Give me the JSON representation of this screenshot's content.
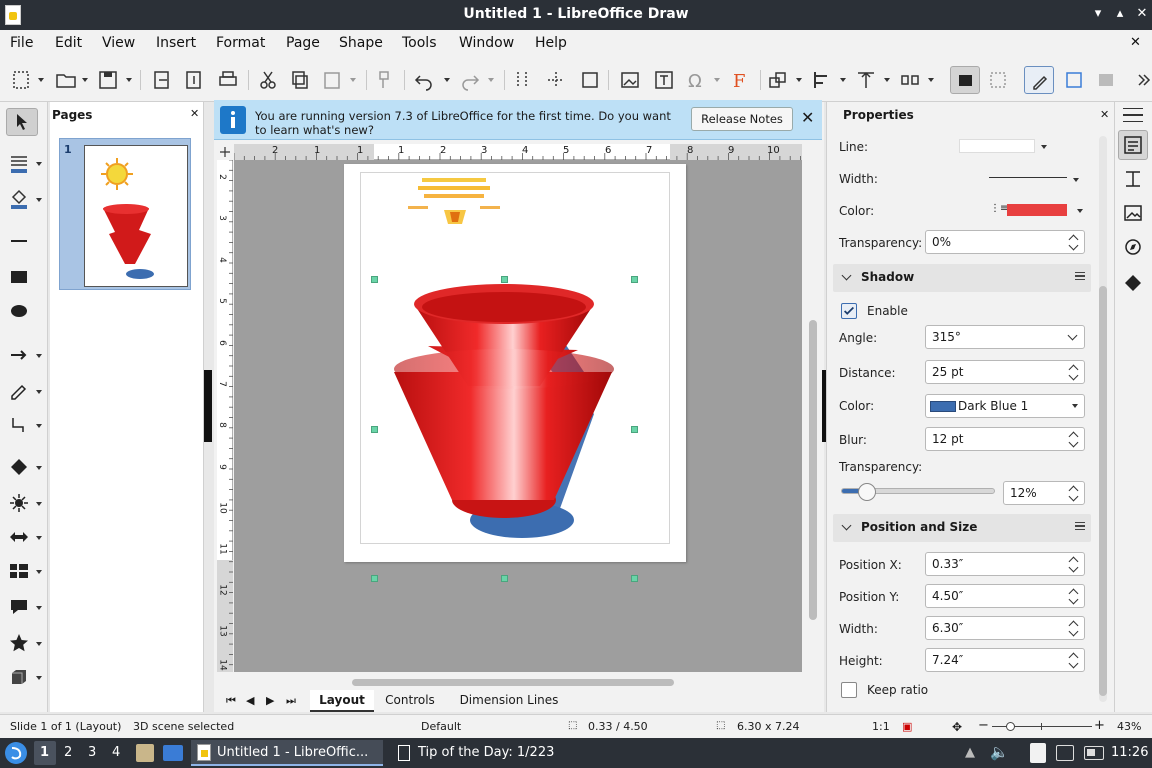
{
  "window": {
    "title": "Untitled 1 - LibreOffice Draw"
  },
  "menu": [
    "File",
    "Edit",
    "View",
    "Insert",
    "Format",
    "Page",
    "Shape",
    "Tools",
    "Window",
    "Help"
  ],
  "pages_panel": {
    "title": "Pages",
    "page_number": "1"
  },
  "infobar": {
    "message": "You are running version 7.3 of LibreOffice for the first time. Do you want to learn what's new?",
    "release_notes_label": "Release Notes"
  },
  "ruler_h": [
    "2",
    "1",
    "1",
    "1",
    "2",
    "3",
    "4",
    "5",
    "6",
    "7",
    "8",
    "9",
    "10"
  ],
  "ruler_v": [
    "2",
    "3",
    "4",
    "5",
    "6",
    "7",
    "8",
    "9",
    "10",
    "11",
    "12",
    "13",
    "14"
  ],
  "properties": {
    "title": "Properties",
    "line_label": "Line:",
    "width_label": "Width:",
    "color_label": "Color:",
    "line_color": "#e84040",
    "transparency_label": "Transparency:",
    "transparency_value": "0%",
    "shadow": {
      "title": "Shadow",
      "enable_label": "Enable",
      "enabled": true,
      "angle_label": "Angle:",
      "angle_value": "315°",
      "distance_label": "Distance:",
      "distance_value": "25 pt",
      "color_label": "Color:",
      "color_name": "Dark Blue 1",
      "color_hex": "#3c6db0",
      "blur_label": "Blur:",
      "blur_value": "12 pt",
      "transparency_label": "Transparency:",
      "transparency_value": "12%",
      "transparency_fraction": 0.12
    },
    "position_size": {
      "title": "Position and Size",
      "pos_x_label": "Position X:",
      "pos_x_value": "0.33″",
      "pos_y_label": "Position Y:",
      "pos_y_value": "4.50″",
      "width_label": "Width:",
      "width_value": "6.30″",
      "height_label": "Height:",
      "height_value": "7.24″",
      "keep_ratio_label": "Keep ratio"
    }
  },
  "tabs": [
    "Layout",
    "Controls",
    "Dimension Lines"
  ],
  "status": {
    "slide": "Slide 1 of 1 (Layout)",
    "selection": "3D scene selected",
    "style": "Default",
    "position": "0.33 / 4.50",
    "size": "6.30 x 7.24",
    "scale": "1:1",
    "zoom": "43%"
  },
  "taskbar": {
    "workspaces": [
      "1",
      "2",
      "3",
      "4"
    ],
    "task_draw": "Untitled 1 - LibreOffic...",
    "task_tip": "Tip of the Day: 1/223",
    "clock": "11:26"
  }
}
